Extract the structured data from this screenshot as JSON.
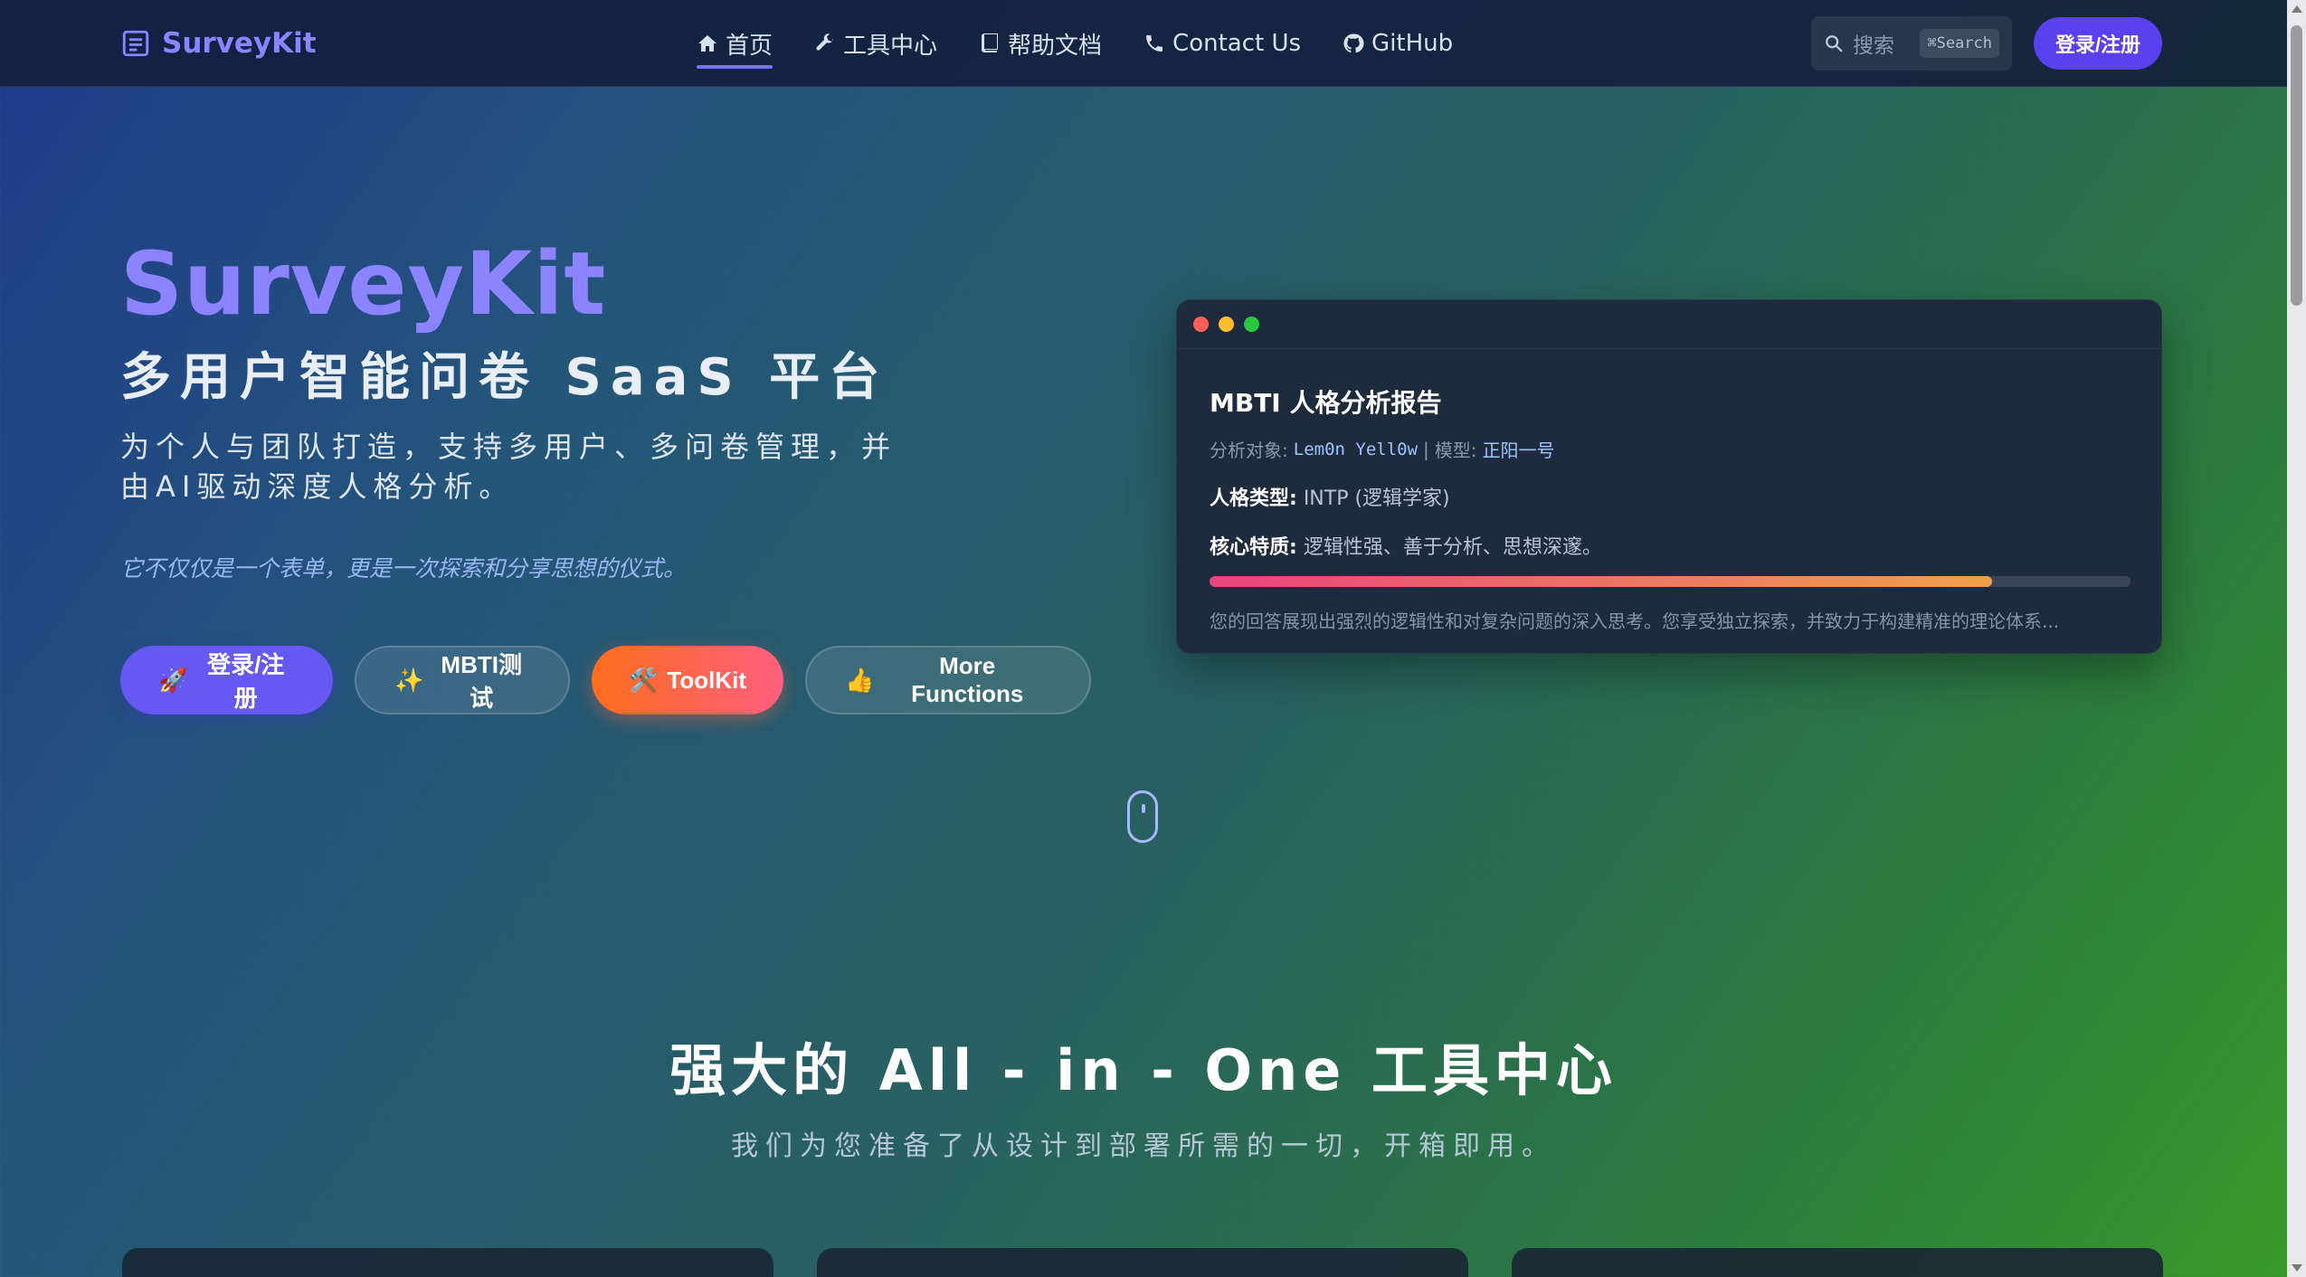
{
  "nav": {
    "brand": "SurveyKit",
    "items": [
      {
        "label": "首页",
        "icon": "home-icon",
        "active": true
      },
      {
        "label": "工具中心",
        "icon": "wrench-icon",
        "active": false
      },
      {
        "label": "帮助文档",
        "icon": "book-icon",
        "active": false
      },
      {
        "label": "Contact Us",
        "icon": "phone-icon",
        "active": false
      },
      {
        "label": "GitHub",
        "icon": "github-icon",
        "active": false
      }
    ],
    "search_placeholder": "搜索",
    "search_shortcut": "⌘Search",
    "login_label": "登录/注册"
  },
  "hero": {
    "title": "SurveyKit",
    "subtitle": "多用户智能问卷 SaaS 平台",
    "description": "为个人与团队打造，支持多用户、多问卷管理，并由AI驱动深度人格分析。",
    "tagline": "它不仅仅是一个表单，更是一次探索和分享思想的仪式。",
    "buttons": [
      {
        "emoji": "🚀",
        "label": "登录/注册"
      },
      {
        "emoji": "✨",
        "label": "MBTI测试"
      },
      {
        "emoji": "🛠️",
        "label": "ToolKit"
      },
      {
        "emoji": "👍",
        "label": "More Functions"
      }
    ]
  },
  "preview": {
    "title": "MBTI 人格分析报告",
    "meta_subject_label": "分析对象:",
    "meta_subject": "Lem0n Yell0w",
    "meta_separator": "|",
    "meta_model_label": "模型:",
    "meta_model": "正阳一号",
    "type_label": "人格类型:",
    "type_value": "INTP (逻辑学家)",
    "trait_label": "核心特质:",
    "trait_value": "逻辑性强、善于分析、思想深邃。",
    "progress": 0.85,
    "summary": "您的回答展现出强烈的逻辑性和对复杂问题的深入思考。您享受独立探索，并致力于构建精准的理论体系..."
  },
  "section": {
    "title": "强大的 All - in - One 工具中心",
    "subtitle": "我们为您准备了从设计到部署所需的一切，开箱即用。"
  },
  "colors": {
    "accent": "#6658f2",
    "brand": "#8b83ff",
    "orange": "#ff6d1e",
    "dot_red": "#ff5f56",
    "dot_yellow": "#ffbd2e",
    "dot_green": "#27c93f"
  }
}
